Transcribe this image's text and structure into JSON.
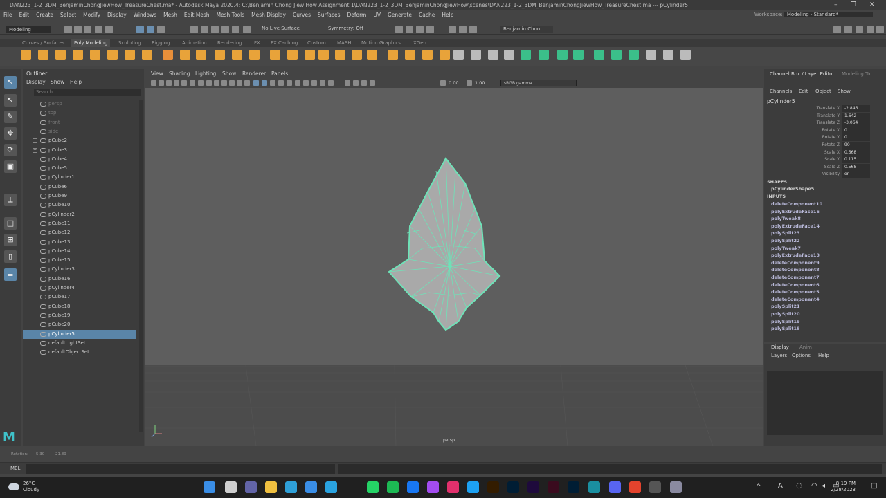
{
  "window": {
    "title": "DAN223_1-2_3DM_BenjaminChongJiewHow_TreasureChest.ma* - Autodesk Maya 2020.4: C:\\Benjamin Chong Jiew How Assignment 1\\DAN223_1-2_3DM_BenjaminChongJiewHow\\scenes\\DAN223_1-2_3DM_BenjaminChongJiewHow_TreasureChest.ma   ---   pCylinder5"
  },
  "menubar": [
    "File",
    "Edit",
    "Create",
    "Select",
    "Modify",
    "Display",
    "Windows",
    "Mesh",
    "Edit Mesh",
    "Mesh Tools",
    "Mesh Display",
    "Curves",
    "Surfaces",
    "Deform",
    "UV",
    "Generate",
    "Cache",
    "Help"
  ],
  "workspace": {
    "label": "Workspace:",
    "value": "Modeling - Standard*"
  },
  "statusline": {
    "mode": "Modeling",
    "live_surface": "No Live Surface",
    "symmetry": "Symmetry: Off",
    "user": "Benjamin Chon..."
  },
  "shelf_tabs": [
    "Curves / Surfaces",
    "Poly Modeling",
    "Sculpting",
    "Rigging",
    "Animation",
    "Rendering",
    "FX",
    "FX Caching",
    "Custom",
    "MASH",
    "Motion Graphics",
    "XGen"
  ],
  "shelf_active_tab": "Poly Modeling",
  "outliner": {
    "title": "Outliner",
    "menu": [
      "Display",
      "Show",
      "Help"
    ],
    "search_placeholder": "Search...",
    "items": [
      {
        "label": "persp",
        "dim": true
      },
      {
        "label": "top",
        "dim": true
      },
      {
        "label": "front",
        "dim": true
      },
      {
        "label": "side",
        "dim": true
      },
      {
        "label": "pCube2",
        "expandable": true
      },
      {
        "label": "pCube3",
        "expandable": true
      },
      {
        "label": "pCube4"
      },
      {
        "label": "pCube5"
      },
      {
        "label": "pCylinder1"
      },
      {
        "label": "pCube6"
      },
      {
        "label": "pCube9"
      },
      {
        "label": "pCube10"
      },
      {
        "label": "pCylinder2"
      },
      {
        "label": "pCube11"
      },
      {
        "label": "pCube12"
      },
      {
        "label": "pCube13"
      },
      {
        "label": "pCube14"
      },
      {
        "label": "pCube15"
      },
      {
        "label": "pCylinder3"
      },
      {
        "label": "pCube16"
      },
      {
        "label": "pCylinder4"
      },
      {
        "label": "pCube17"
      },
      {
        "label": "pCube18"
      },
      {
        "label": "pCube19"
      },
      {
        "label": "pCube20"
      },
      {
        "label": "pCylinder5",
        "selected": true
      },
      {
        "label": "defaultLightSet"
      },
      {
        "label": "defaultObjectSet"
      }
    ]
  },
  "viewport": {
    "menu": [
      "View",
      "Shading",
      "Lighting",
      "Show",
      "Renderer",
      "Panels"
    ],
    "exposure": "0.00",
    "gamma": "1.00",
    "color_space": "sRGB gamma",
    "camera": "persp"
  },
  "channelbox": {
    "title": "Channel Box / Layer Editor",
    "tab2": "Modeling To",
    "menu": [
      "Channels",
      "Edit",
      "Object",
      "Show"
    ],
    "node": "pCylinder5",
    "attributes": [
      {
        "name": "Translate X",
        "value": "-2.846"
      },
      {
        "name": "Translate Y",
        "value": "1.642"
      },
      {
        "name": "Translate Z",
        "value": "-3.064"
      },
      {
        "name": "Rotate X",
        "value": "0"
      },
      {
        "name": "Rotate Y",
        "value": "0"
      },
      {
        "name": "Rotate Z",
        "value": "90"
      },
      {
        "name": "Scale X",
        "value": "0.568"
      },
      {
        "name": "Scale Y",
        "value": "0.115"
      },
      {
        "name": "Scale Z",
        "value": "0.568"
      },
      {
        "name": "Visibility",
        "value": "on"
      }
    ],
    "shapes_label": "SHAPES",
    "shape": "pCylinderShape5",
    "inputs_label": "INPUTS",
    "inputs": [
      "deleteComponent10",
      "polyExtrudeFace15",
      "polyTweak8",
      "polyExtrudeFace14",
      "polySplit23",
      "polySplit22",
      "polyTweak7",
      "polyExtrudeFace13",
      "deleteComponent9",
      "deleteComponent8",
      "deleteComponent7",
      "deleteComponent6",
      "deleteComponent5",
      "deleteComponent4",
      "polySplit21",
      "polySplit20",
      "polySplit19",
      "polySplit18"
    ]
  },
  "layer_editor": {
    "tabs": [
      "Display",
      "Anim"
    ],
    "menu": [
      "Layers",
      "Options",
      "Help"
    ]
  },
  "helpline": {
    "label": "Rotation:",
    "v1": "5.30",
    "v2": "-21.89"
  },
  "cmdline": {
    "label": "MEL"
  },
  "taskbar": {
    "weather_temp": "26°C",
    "weather_desc": "Cloudy",
    "time": "8:19 PM",
    "date": "2/28/2023"
  },
  "colors": {
    "wire": "#6ee3b8",
    "mesh_fill": "#a9a9a9",
    "selection": "#5a85a8"
  }
}
